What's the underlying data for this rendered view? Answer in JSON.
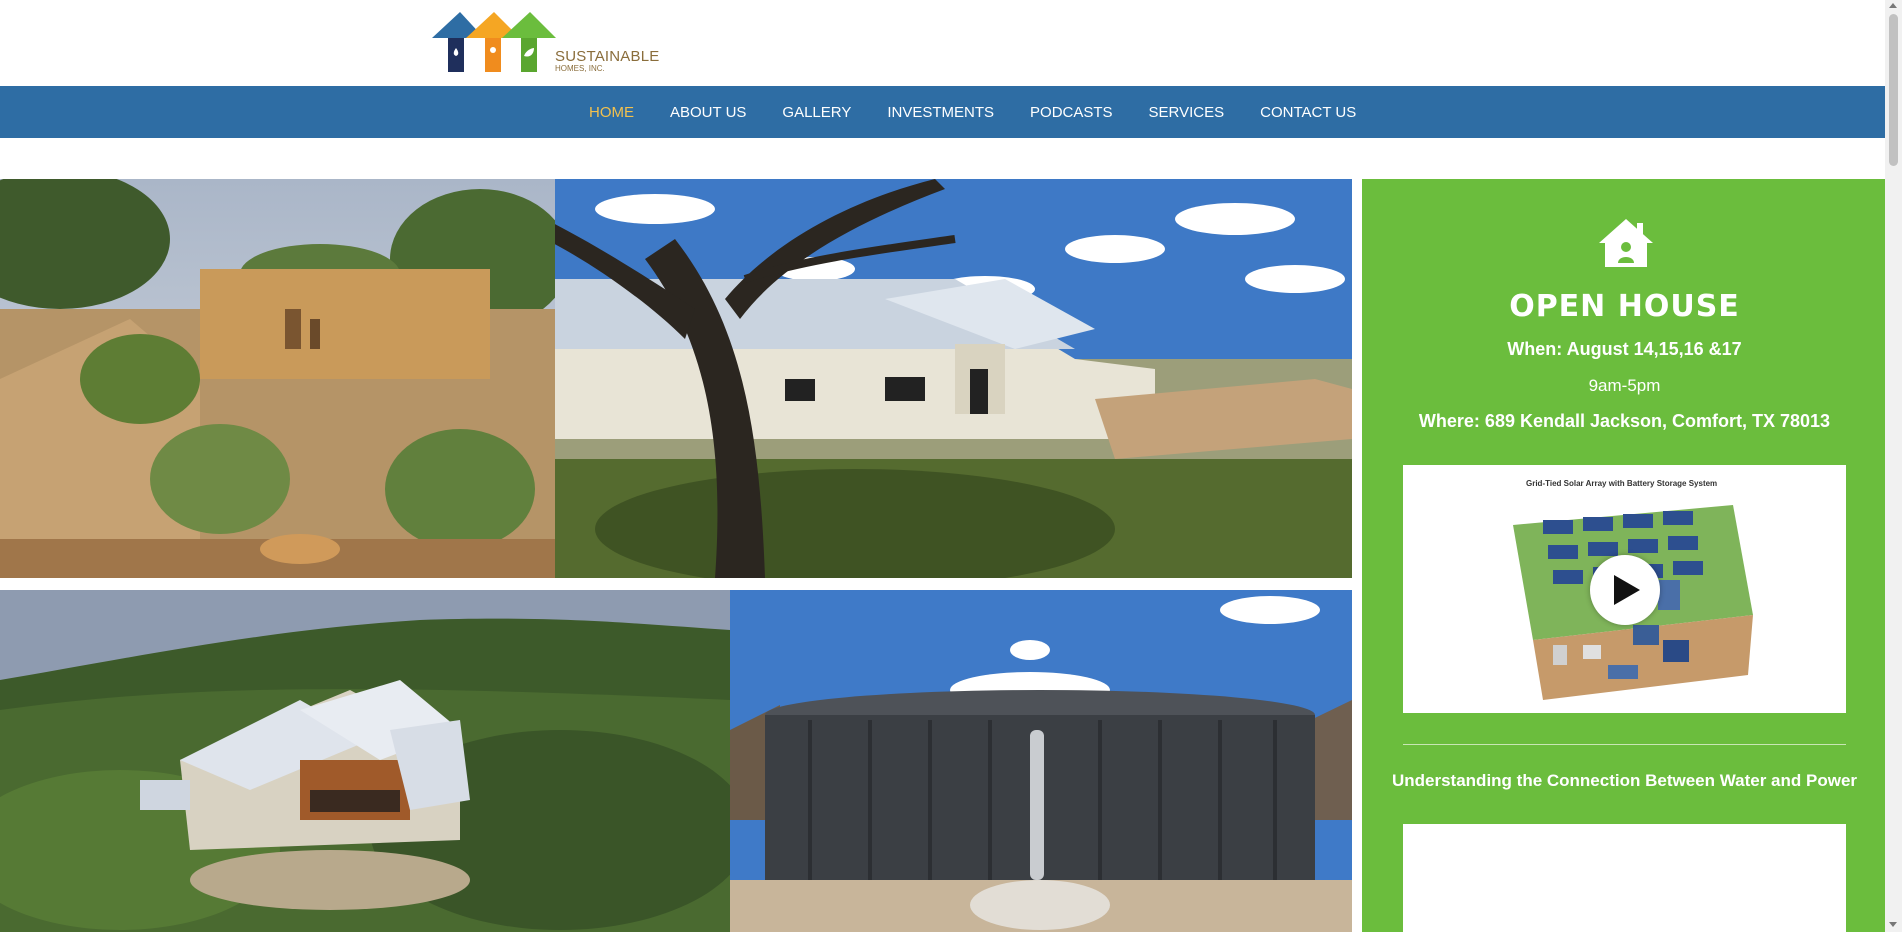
{
  "brand": {
    "name_line1": "SUSTAINABLE",
    "name_line2": "HOMES, INC.",
    "colors": {
      "roof_blue": "#2e6da4",
      "roof_orange": "#f5a623",
      "roof_green": "#6bbd3d",
      "brown": "#8a6d3b"
    }
  },
  "nav": {
    "bg_color": "#2e6da4",
    "active_color": "#f2c14e",
    "items": [
      {
        "label": "HOME",
        "active": true
      },
      {
        "label": "ABOUT US",
        "active": false
      },
      {
        "label": "GALLERY",
        "active": false
      },
      {
        "label": "INVESTMENTS",
        "active": false
      },
      {
        "label": "PODCASTS",
        "active": false
      },
      {
        "label": "SERVICES",
        "active": false
      },
      {
        "label": "CONTACT US",
        "active": false
      }
    ]
  },
  "gallery": {
    "photos": [
      {
        "icon": "stone-house-garden-photo"
      },
      {
        "icon": "ranch-house-oak-tree-photo"
      },
      {
        "icon": "aerial-hill-home-photo"
      },
      {
        "icon": "rainwater-tank-photo"
      }
    ]
  },
  "sidebar": {
    "bg_color": "#6bbd3d",
    "icon": "house-icon",
    "title": "OPEN HOUSE",
    "when": "When: August 14,15,16 &17",
    "time": "9am-5pm",
    "where": "Where: 689 Kendall Jackson, Comfort, TX 78013",
    "video": {
      "caption": "Grid-Tied Solar Array with Battery Storage System",
      "icon": "play-icon"
    },
    "heading": "Understanding the Connection Between Water and Power"
  }
}
